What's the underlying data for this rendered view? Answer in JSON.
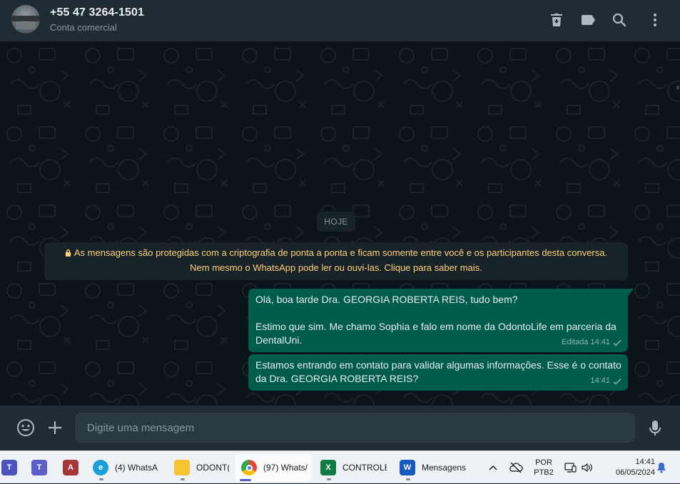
{
  "header": {
    "contact_name": "+55 47 3264-1501",
    "contact_subtitle": "Conta comercial",
    "icons": [
      "delete-icon",
      "label-icon",
      "search-icon",
      "menu-icon"
    ]
  },
  "chat": {
    "date_chip": "HOJE",
    "encryption_notice": "As mensagens são protegidas com a criptografia de ponta a ponta e ficam somente entre você e os participantes desta conversa. Nem mesmo o WhatsApp pode ler ou ouvi-las. Clique para saber mais.",
    "messages": [
      {
        "line1": "Olá, boa tarde Dra. GEORGIA ROBERTA REIS, tudo bem?",
        "line2": "Estimo que sim. Me chamo Sophia e falo em nome da OdontoLife em parceria da DentalUni.",
        "meta": "Editada 14:41"
      },
      {
        "line1": "Estamos entrando em contato para validar algumas informações. Esse é o contato da Dra. GEORGIA ROBERTA REIS?",
        "meta": "14:41"
      }
    ]
  },
  "composer": {
    "placeholder": "Digite uma mensagem"
  },
  "taskbar": {
    "items": [
      {
        "label": ""
      },
      {
        "label": ""
      },
      {
        "label": ""
      },
      {
        "label": "(4) WhatsA"
      },
      {
        "label": "ODONT("
      },
      {
        "label": "(97) Whats/"
      },
      {
        "label": "CONTROLE"
      },
      {
        "label": "Mensagens"
      }
    ],
    "lang_line1": "POR",
    "lang_line2": "PTB2",
    "time": "14:41",
    "date": "06/05/2024"
  },
  "colors": {
    "header_bg": "#202c33",
    "chat_bg": "#0b141a",
    "outgoing_bubble": "#005c4b",
    "notice_text": "#ffd279",
    "taskbar_bg": "#eef1f6"
  }
}
